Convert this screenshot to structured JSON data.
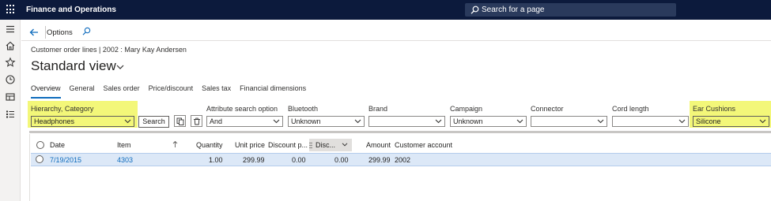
{
  "topbar": {
    "app_title": "Finance and Operations",
    "search_label": "Search for a page"
  },
  "actionbar": {
    "options_label": "Options"
  },
  "breadcrumb": "Customer order lines  |  2002 : Mary Kay Andersen",
  "page_title": "Standard view",
  "tabs": [
    {
      "label": "Overview",
      "active": true
    },
    {
      "label": "General"
    },
    {
      "label": "Sales order"
    },
    {
      "label": "Price/discount"
    },
    {
      "label": "Sales tax"
    },
    {
      "label": "Financial dimensions"
    }
  ],
  "filters": {
    "hierarchy": {
      "label": "Hierarchy, Category",
      "value": "Headphones"
    },
    "search_button": "Search",
    "attribute_search": {
      "label": "Attribute search option",
      "value": "And"
    },
    "bluetooth": {
      "label": "Bluetooth",
      "value": "Unknown"
    },
    "brand": {
      "label": "Brand",
      "value": ""
    },
    "campaign": {
      "label": "Campaign",
      "value": "Unknown"
    },
    "connector": {
      "label": "Connector",
      "value": ""
    },
    "cord_length": {
      "label": "Cord length",
      "value": ""
    },
    "ear_cushions": {
      "label": "Ear Cushions",
      "value": "Silicone"
    }
  },
  "grid": {
    "columns": [
      "Date",
      "Item",
      "Quantity",
      "Unit price",
      "Discount p...",
      "Disc...",
      "Amount",
      "Customer account"
    ],
    "rows": [
      {
        "date": "7/19/2015",
        "item": "4303",
        "quantity": "1.00",
        "unit_price": "299.99",
        "discount_pct": "0.00",
        "discount": "0.00",
        "amount": "299.99",
        "customer_account": "2002"
      }
    ]
  },
  "colors": {
    "topbar": "#0c1a3c",
    "highlight": "#f3f779",
    "accent": "#0f6cbd",
    "selected_row": "#dce8f7"
  }
}
